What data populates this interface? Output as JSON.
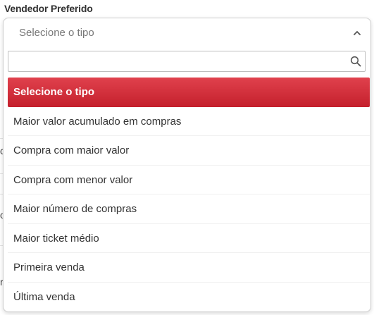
{
  "field": {
    "label": "Vendedor Preferido"
  },
  "select": {
    "current_value": "Selecione o tipo",
    "chevron_icon": "chevron-up-icon",
    "expanded": true
  },
  "search": {
    "value": "",
    "placeholder": "",
    "icon": "search-icon"
  },
  "options": [
    {
      "label": "Selecione o tipo",
      "selected": true
    },
    {
      "label": "Maior valor acumulado em compras",
      "selected": false
    },
    {
      "label": "Compra com maior valor",
      "selected": false
    },
    {
      "label": "Compra com menor valor",
      "selected": false
    },
    {
      "label": "Maior número de compras",
      "selected": false
    },
    {
      "label": "Maior ticket médio",
      "selected": false
    },
    {
      "label": "Primeira venda",
      "selected": false
    },
    {
      "label": "Última venda",
      "selected": false
    }
  ],
  "background_fragments": {
    "chars": [
      "c",
      "o",
      "r"
    ]
  },
  "colors": {
    "selected_bg": "#d3303b",
    "text": "#333333",
    "placeholder_text": "#777777",
    "border": "#cfcfcf"
  }
}
